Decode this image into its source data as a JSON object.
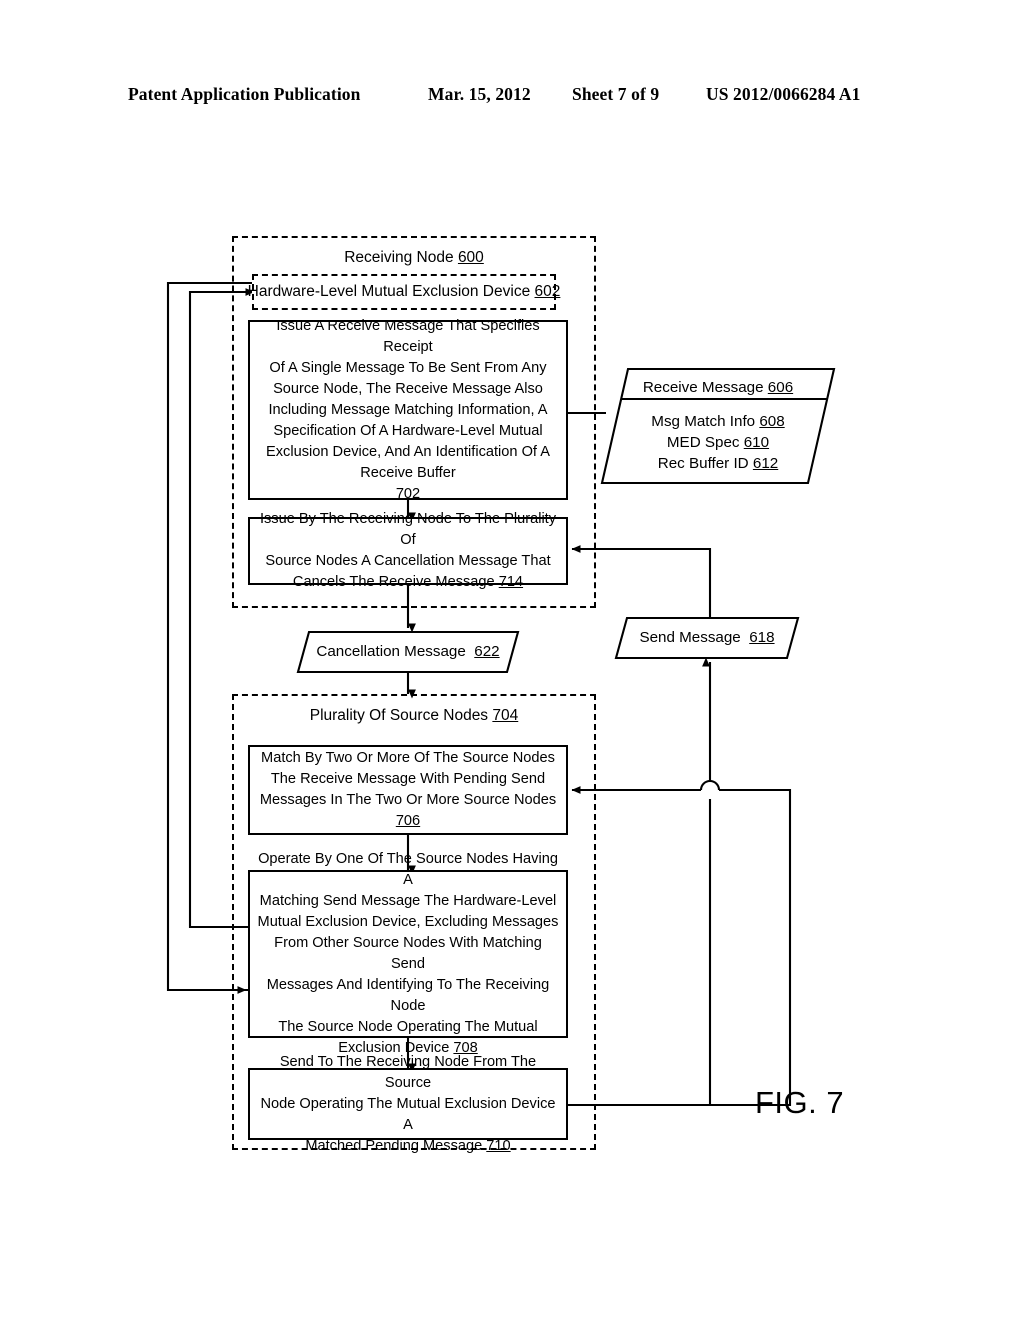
{
  "header": {
    "publication": "Patent Application Publication",
    "date": "Mar. 15, 2012",
    "sheet": "Sheet 7 of 9",
    "number": "US 2012/0066284 A1"
  },
  "figure": {
    "label": "FIG. 7"
  },
  "groups": {
    "receiving_node": {
      "title": "Receiving Node",
      "ref": "600"
    },
    "source_nodes": {
      "title": "Plurality Of Source Nodes",
      "ref": "704"
    }
  },
  "boxes": {
    "med_602": {
      "text": "Hardware-Level Mutual Exclusion Device",
      "ref": "602"
    },
    "step_702": {
      "lines": [
        "Issue A Receive Message That Specifies Receipt",
        "Of A Single Message To Be Sent From Any",
        "Source Node, The Receive Message Also",
        "Including Message Matching Information, A",
        "Specification Of A Hardware-Level Mutual",
        "Exclusion Device, And An Identification Of A",
        "Receive Buffer"
      ],
      "ref": "702"
    },
    "step_714": {
      "lines": [
        "Issue By The Receiving Node To The Plurality Of",
        "Source Nodes A Cancellation Message That",
        "Cancels The Receive Message"
      ],
      "ref": "714",
      "ref_inline": true
    },
    "step_706": {
      "lines": [
        "Match By Two Or More Of The Source Nodes",
        "The Receive Message With Pending Send",
        "Messages In The Two Or More Source Nodes"
      ],
      "ref": "706"
    },
    "step_708": {
      "lines": [
        "Operate By One Of The Source Nodes Having A",
        "Matching Send Message The Hardware-Level",
        "Mutual Exclusion Device, Excluding Messages",
        "From Other Source Nodes With Matching Send",
        "Messages And Identifying To The Receiving Node",
        "The Source Node Operating The Mutual",
        "Exclusion Device"
      ],
      "ref": "708",
      "ref_inline": true
    },
    "step_710": {
      "lines": [
        "Send To The Receiving Node From The Source",
        "Node Operating The Mutual Exclusion Device A",
        "Matched Pending Message"
      ],
      "ref": "710",
      "ref_inline": true
    }
  },
  "data_symbols": {
    "receive_message_606": {
      "title": "Receive Message",
      "ref": "606",
      "fields": [
        {
          "label": "Msg Match Info",
          "ref": "608"
        },
        {
          "label": "MED Spec",
          "ref": "610"
        },
        {
          "label": "Rec Buffer ID",
          "ref": "612"
        }
      ]
    },
    "cancellation_message_622": {
      "title": "Cancellation Message",
      "ref": "622"
    },
    "send_message_618": {
      "title": "Send Message",
      "ref": "618"
    }
  },
  "colors": {
    "ink": "#000000",
    "paper": "#ffffff"
  }
}
